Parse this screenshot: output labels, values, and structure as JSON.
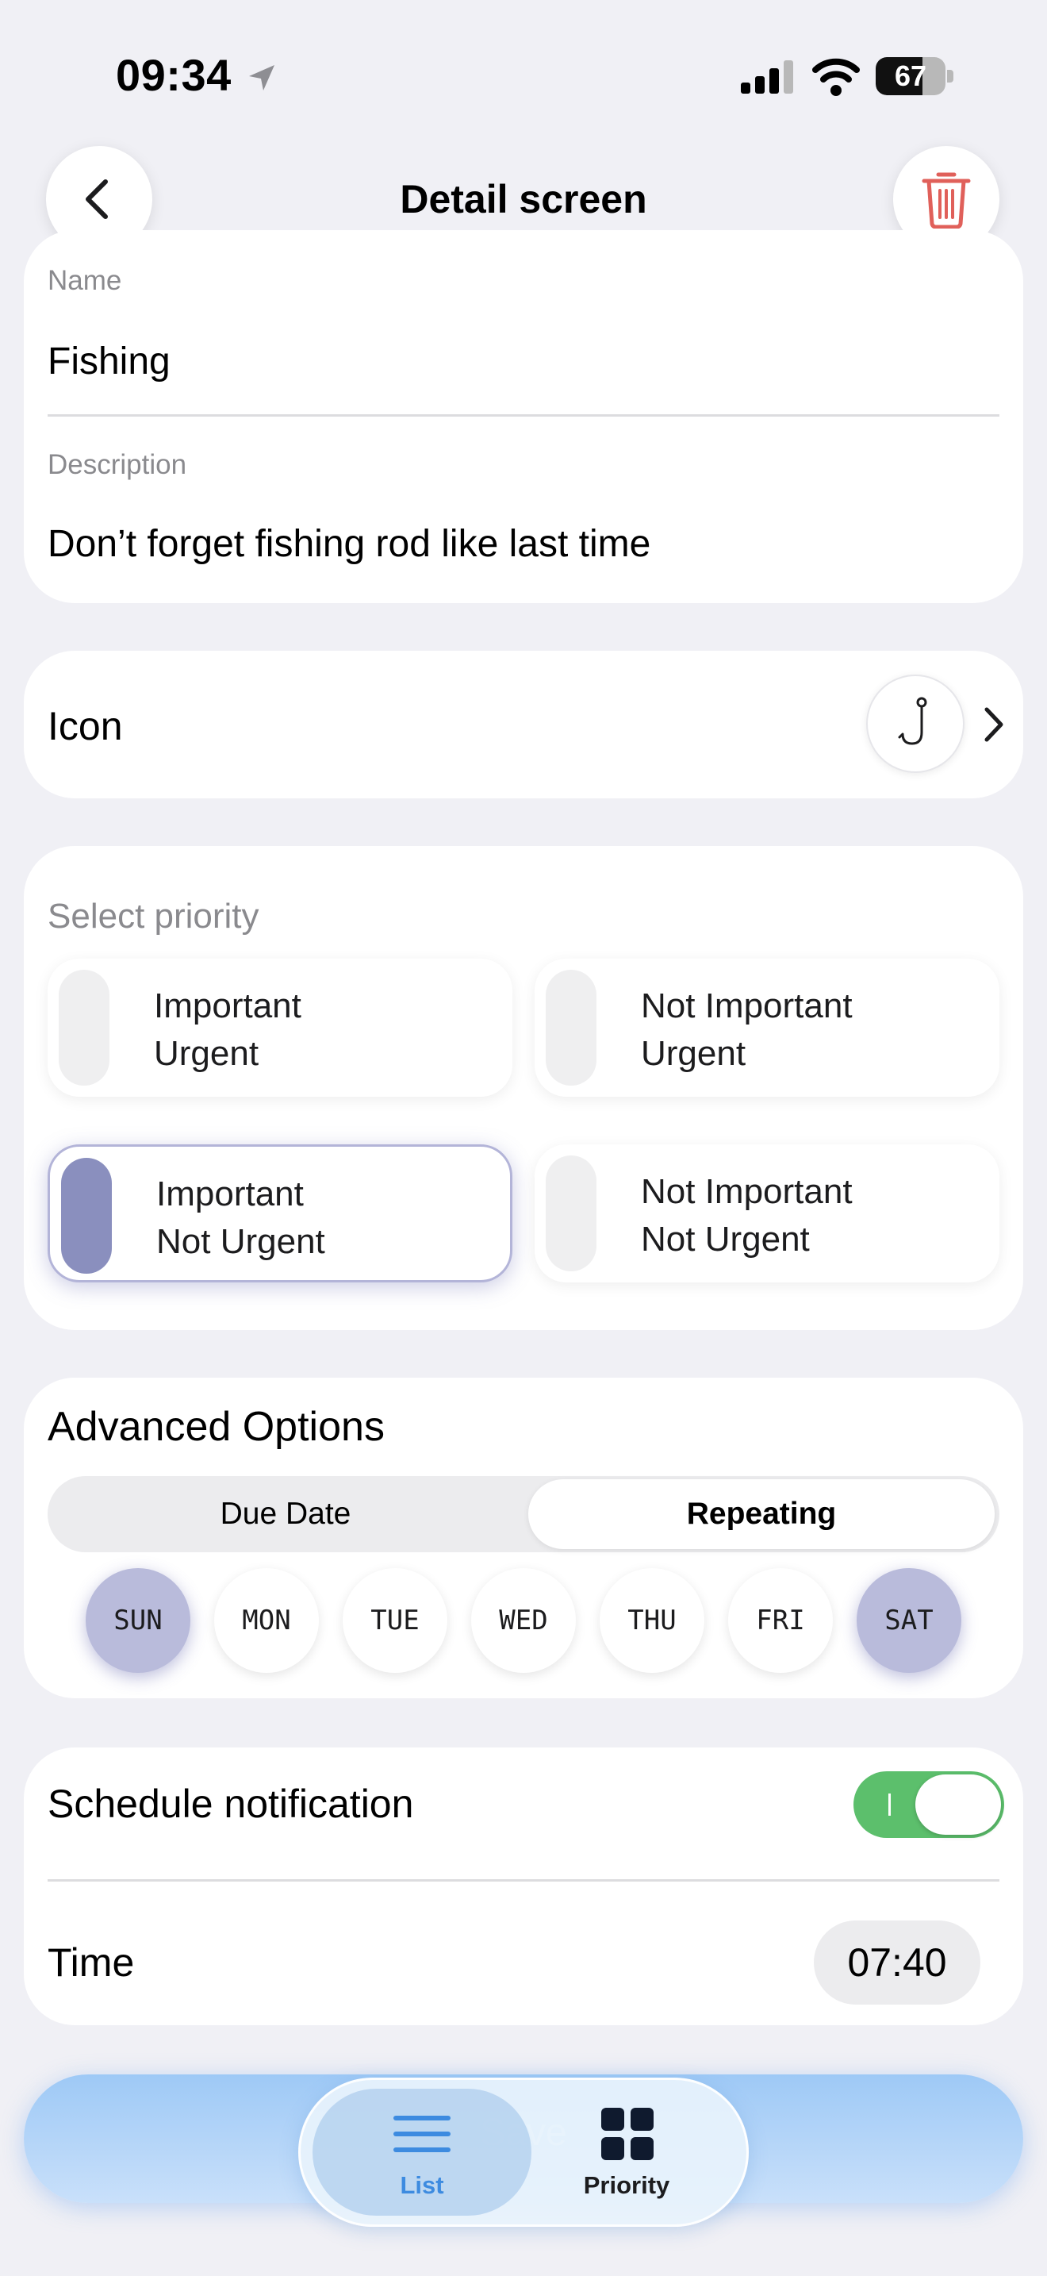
{
  "status_bar": {
    "time": "09:34",
    "battery": "67",
    "battery_level": 0.67
  },
  "nav": {
    "title": "Detail screen",
    "back_icon": "chevron-left-icon",
    "delete_icon": "trash-icon"
  },
  "fields": {
    "name_label": "Name",
    "name_value": "Fishing",
    "description_label": "Description",
    "description_value": "Don’t forget fishing rod like last time"
  },
  "icon_row": {
    "label": "Icon",
    "selected_icon": "fishing-hook-icon"
  },
  "priority": {
    "title": "Select priority",
    "options": [
      {
        "line1": "Important",
        "line2": "Urgent",
        "selected": false
      },
      {
        "line1": "Not Important",
        "line2": "Urgent",
        "selected": false
      },
      {
        "line1": "Important",
        "line2": "Not Urgent",
        "selected": true
      },
      {
        "line1": "Not Important",
        "line2": "Not Urgent",
        "selected": false
      }
    ]
  },
  "advanced": {
    "title": "Advanced Options",
    "segments": [
      "Due Date",
      "Repeating"
    ],
    "selected_segment": "Repeating",
    "days": [
      {
        "label": "SUN",
        "on": true
      },
      {
        "label": "MON",
        "on": false
      },
      {
        "label": "TUE",
        "on": false
      },
      {
        "label": "WED",
        "on": false
      },
      {
        "label": "THU",
        "on": false
      },
      {
        "label": "FRI",
        "on": false
      },
      {
        "label": "SAT",
        "on": true
      }
    ]
  },
  "notification": {
    "label": "Schedule notification",
    "enabled": true,
    "time_label": "Time",
    "time_value": "07:40"
  },
  "save": {
    "label": "Save"
  },
  "tabbar": {
    "tabs": [
      {
        "label": "List",
        "icon": "list-icon",
        "active": true
      },
      {
        "label": "Priority",
        "icon": "grid-icon",
        "active": false
      }
    ]
  },
  "colors": {
    "accent": "#8a8fbe",
    "toggle_on": "#5cbf6c",
    "tab_active": "#3d8be0",
    "trash": "#e0605a"
  }
}
